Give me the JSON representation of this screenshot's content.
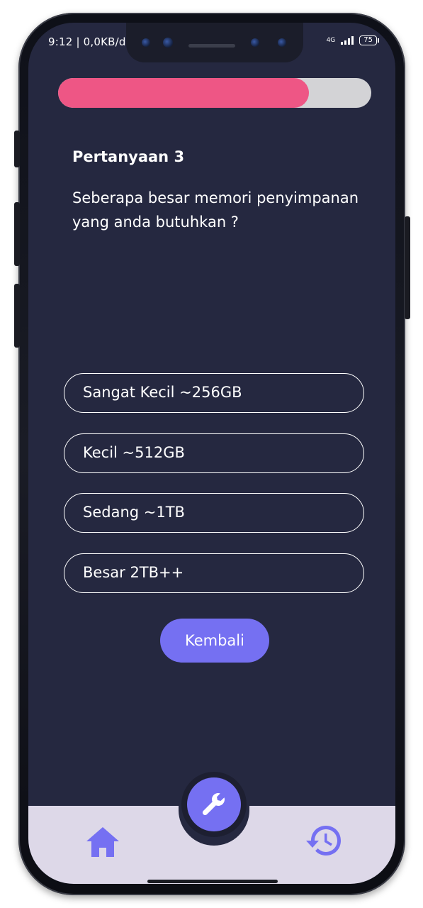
{
  "status_bar": {
    "time_data": "9:12 | 0,0KB/d",
    "network": "4G",
    "battery": "75"
  },
  "quiz": {
    "progress": 0.8,
    "progress_color": "#ee5685",
    "question_title": "Pertanyaan 3",
    "question_text": "Seberapa besar memori penyimpanan yang anda butuhkan ?",
    "answers": [
      "Sangat Kecil ~256GB",
      "Kecil ~512GB",
      "Sedang ~1TB",
      "Besar 2TB++"
    ],
    "back_label": "Kembali"
  },
  "bottom_nav": {
    "items": [
      {
        "icon": "home-icon"
      },
      {
        "icon": "wrench-icon"
      },
      {
        "icon": "history-icon"
      }
    ],
    "accent": "#7570f2",
    "background": "#ddd8e8"
  },
  "theme": {
    "background": "#252840"
  }
}
